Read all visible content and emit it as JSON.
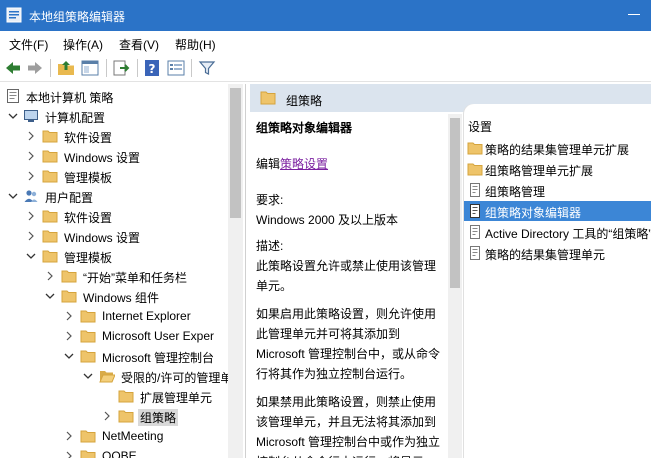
{
  "window": {
    "title": "本地组策略编辑器"
  },
  "menu": [
    "文件(F)",
    "操作(A)",
    "查看(V)",
    "帮助(H)"
  ],
  "toolbar": {
    "buttons": [
      "back-icon",
      "forward-icon",
      "up-folder-icon",
      "show-hide-tree-icon",
      "export-list-icon",
      "help-icon",
      "properties-icon",
      "filter-icon"
    ]
  },
  "tree": {
    "root": "本地计算机 策略",
    "computer_config": "计算机配置",
    "cc_software": "软件设置",
    "cc_windows": "Windows 设置",
    "cc_admin": "管理模板",
    "user_config": "用户配置",
    "uc_software": "软件设置",
    "uc_windows": "Windows 设置",
    "uc_admin": "管理模板",
    "start_menu": "“开始”菜单和任务栏",
    "windows_components": "Windows 组件",
    "ie": "Internet Explorer",
    "ms_user_exp": "Microsoft User Exper",
    "ms_mmc": "Microsoft 管理控制台",
    "restricted": "受限的/许可的管理单",
    "ext_snapins": "扩展管理单元",
    "group_policy": "组策略",
    "netmeeting": "NetMeeting",
    "oobe": "OOBE"
  },
  "right": {
    "header": "组策略",
    "desc": {
      "title": "组策略对象编辑器",
      "edit_prefix": "编辑",
      "edit_link": "策略设置",
      "req_label": "要求:",
      "req_value": "Windows 2000 及以上版本",
      "desc_label": "描述:",
      "desc_1": "此策略设置允许或禁止使用该管理单元。",
      "desc_2": "如果启用此策略设置，则允许使用此管理单元并可将其添加到 Microsoft 管理控制台中，或从命令行将其作为独立控制台运行。",
      "desc_3": "如果禁用此策略设置，则禁止使用该管理单元，并且无法将其添加到 Microsoft 管理控制台中或作为独立控制台从命令行中运行。将显示"
    },
    "column_header": "设置",
    "items": [
      {
        "icon": "folder",
        "label": "策略的结果集管理单元扩展"
      },
      {
        "icon": "folder",
        "label": "组策略管理单元扩展"
      },
      {
        "icon": "setting",
        "label": "组策略管理"
      },
      {
        "icon": "setting",
        "label": "组策略对象编辑器",
        "selected": true
      },
      {
        "icon": "setting",
        "label": "Active Directory 工具的“组策略”"
      },
      {
        "icon": "setting",
        "label": "策略的结果集管理单元"
      }
    ]
  },
  "colors": {
    "titlebar": "#2b73c7",
    "selection": "#3c86d6",
    "header": "#dbe4ee",
    "link": "#7b20a0"
  }
}
